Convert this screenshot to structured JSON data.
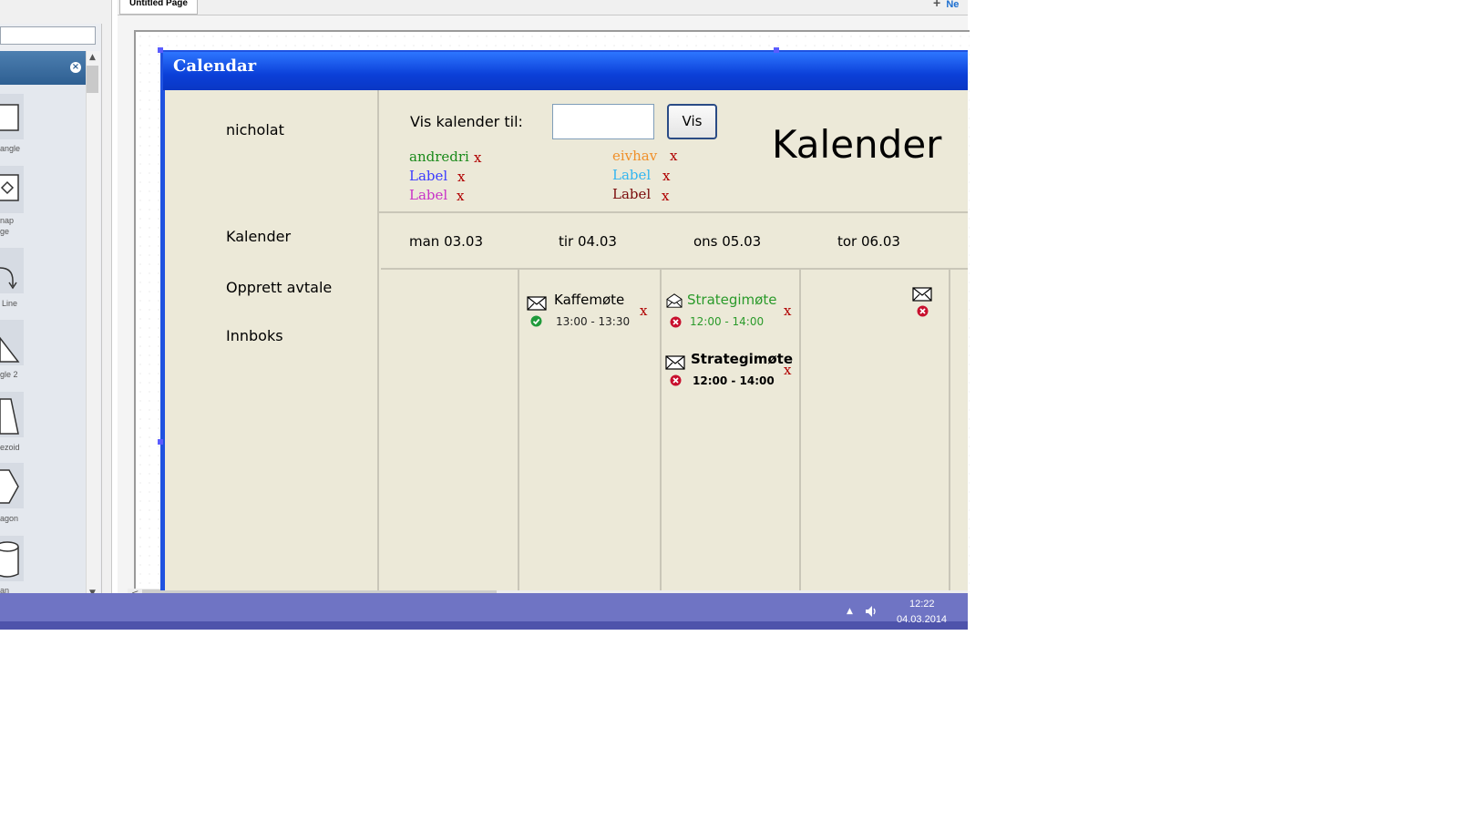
{
  "palette": {
    "close_glyph": "×",
    "shapes": [
      {
        "label": "angle",
        "icon": "rectangle-icon"
      },
      {
        "label": "nap",
        "icon": "map-page-icon"
      },
      {
        "label": "ge",
        "icon": "map-page-icon"
      },
      {
        "label": "Line",
        "icon": "curved-line-icon"
      },
      {
        "label": "gle 2",
        "icon": "triangle-icon"
      },
      {
        "label": "ezoid",
        "icon": "trapezoid-icon"
      },
      {
        "label": "agon",
        "icon": "hexagon-icon"
      },
      {
        "label": "an",
        "icon": "cylinder-icon"
      }
    ]
  },
  "tabs": {
    "page_tab": "Untitled Page",
    "new_tab": "Ne"
  },
  "calendar": {
    "window_title": "Calendar",
    "user": "nicholat",
    "nav": {
      "kalender": "Kalender",
      "opprett": "Opprett avtale",
      "innboks": "Innboks"
    },
    "vis_label": "Vis kalender til:",
    "vis_input_value": "",
    "vis_button": "Vis",
    "big_title": "Kalender",
    "x": "x",
    "shared_left": [
      {
        "name": "andredri",
        "color": "#1a8a1a"
      },
      {
        "name": "Label",
        "color": "#3b3bff"
      },
      {
        "name": "Label",
        "color": "#c832c8"
      }
    ],
    "shared_right": [
      {
        "name": "eivhav",
        "color": "#f0902a"
      },
      {
        "name": "Label",
        "color": "#33b5f0"
      },
      {
        "name": "Label",
        "color": "#7a0a0a"
      }
    ],
    "days": [
      "man 03.03",
      "tir 04.03",
      "ons 05.03",
      "tor 06.03"
    ],
    "events": [
      {
        "title": "Kaffemøte",
        "time": "13:00 - 13:30",
        "status": "accepted",
        "color": "#000000"
      },
      {
        "title": "Strategimøte",
        "time": "12:00 - 14:00",
        "status": "declined",
        "color": "#2a9a2a"
      },
      {
        "title": "Strategimøte",
        "time": "12:00 - 14:00",
        "status": "declined",
        "color": "#000000"
      }
    ]
  },
  "taskbar": {
    "time": "12:22",
    "date": "04.03.2014"
  }
}
